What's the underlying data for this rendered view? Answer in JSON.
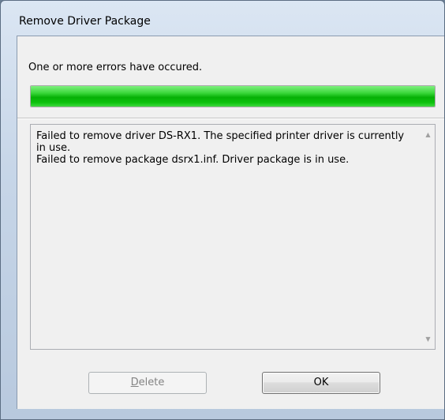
{
  "window": {
    "title": "Remove Driver Package"
  },
  "status": {
    "text": "One or more errors have occured.",
    "progress_percent": 100
  },
  "messages": [
    "Failed to remove driver DS-RX1. The specified printer driver is currently in use.",
    "Failed to remove package dsrx1.inf. Driver package is in use."
  ],
  "scrollbar": {
    "up_icon": "triangle-up",
    "down_icon": "triangle-down"
  },
  "buttons": {
    "delete_label_mnemonic": "D",
    "delete_label_rest": "elete",
    "ok_label": "OK"
  },
  "colors": {
    "progress_fill": "#06b006"
  }
}
